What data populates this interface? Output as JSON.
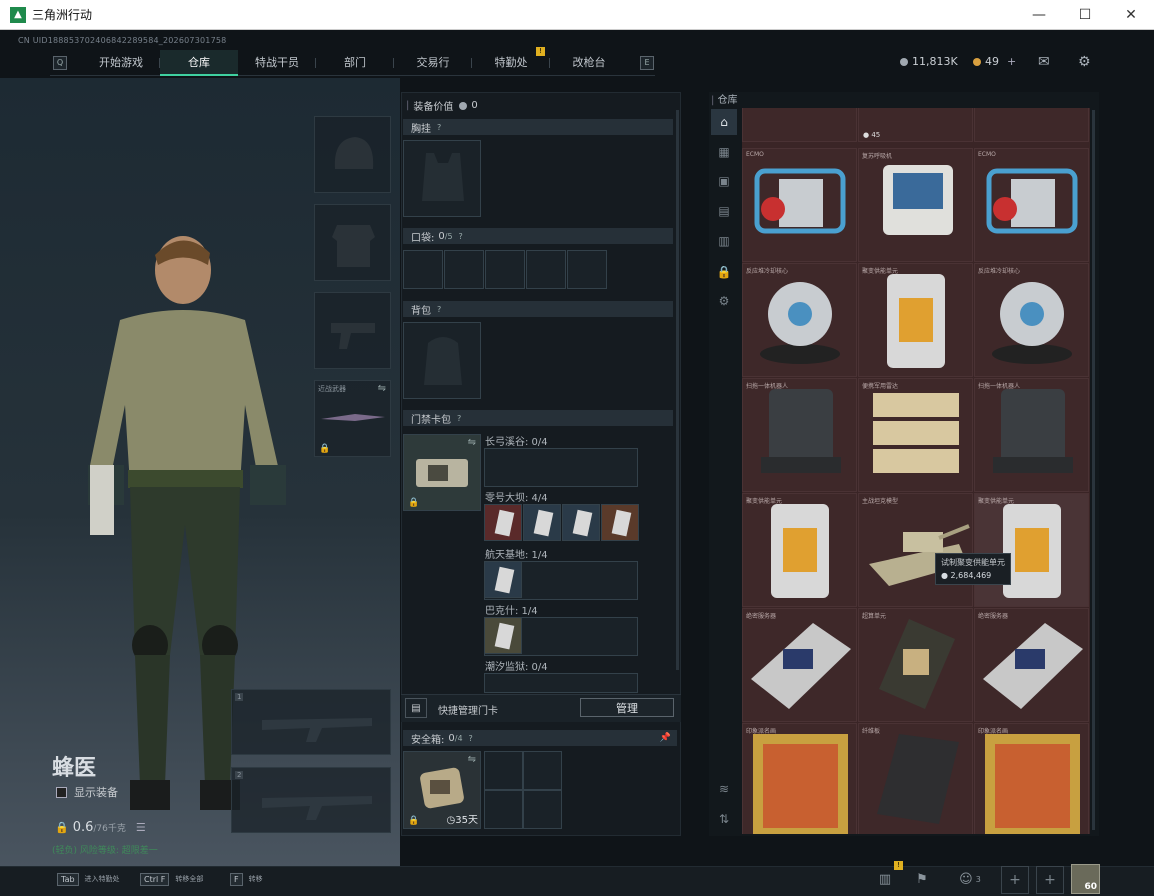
{
  "window": {
    "title": "三角洲行动",
    "minimize": "—",
    "maximize": "☐",
    "close": "✕"
  },
  "uid": "CN UID18885370240684228958​4_202607301758",
  "nav": {
    "left_key": "Q",
    "right_key": "E",
    "tabs": [
      {
        "label": "开始游戏"
      },
      {
        "label": "仓库"
      },
      {
        "label": "特战干员"
      },
      {
        "label": "部门"
      },
      {
        "label": "交易行"
      },
      {
        "label": "特勤处"
      },
      {
        "label": "改枪台"
      }
    ],
    "badge": "!"
  },
  "currency": {
    "primary": "11,813K",
    "secondary": "49"
  },
  "character": {
    "name": "蜂医",
    "show_gear": "显示装备",
    "weight": "0.6",
    "weight_max": "/76千克",
    "status_line": "(轻负) 风险等级: 超限差一",
    "slot_side_label": "近战武器",
    "weapon_slot1": "1",
    "weapon_slot2": "2"
  },
  "mid": {
    "value_label": "装备价值",
    "value": "0",
    "chest_label": "胸挂",
    "pocket_label": "口袋:",
    "pocket_count": "0",
    "pocket_max": "/5",
    "backpack_label": "背包",
    "cardpack_label": "门禁卡包",
    "card_rows": [
      {
        "label": "长弓溪谷: 0/4"
      },
      {
        "label": "零号大坝: 4/4"
      },
      {
        "label": "航天基地: 1/4"
      },
      {
        "label": "巴克什: 1/4"
      },
      {
        "label": "潮汐监狱: 0/4"
      }
    ],
    "quick_manage": "快捷管理门卡",
    "manage_button": "管理",
    "safe_label": "安全箱:",
    "safe_count": "0",
    "safe_max": "/4",
    "safe_time": "35天",
    "q": "?"
  },
  "warehouse": {
    "title": "仓库",
    "top_badge": "45",
    "items": [
      {
        "name": "ECMO"
      },
      {
        "name": "复苏呼吸机"
      },
      {
        "name": "ECMO"
      },
      {
        "name": "反应堆冷却核心"
      },
      {
        "name": "聚变供能单元"
      },
      {
        "name": "反应堆冷却核心"
      },
      {
        "name": "扫拖一体机器人"
      },
      {
        "name": "便携军用雷达"
      },
      {
        "name": "扫拖一体机器人"
      },
      {
        "name": "聚变供能单元"
      },
      {
        "name": "主战坦克模型"
      },
      {
        "name": "聚变供能单元"
      },
      {
        "name": "绝密服务器"
      },
      {
        "name": "超算单元"
      },
      {
        "name": "绝密服务器"
      },
      {
        "name": "印象派名画"
      },
      {
        "name": "纤维板"
      },
      {
        "name": "印象派名画"
      }
    ],
    "tooltip_name": "试制聚变供能单元",
    "tooltip_value": "2,684,469"
  },
  "bottom": {
    "hint1_key": "Tab",
    "hint1_label": "进入特勤处",
    "hint2_key": "Ctrl F",
    "hint2_label": "转移全部",
    "hint3_key": "F",
    "hint3_label": "转移",
    "team_count": "3",
    "level": "60"
  }
}
